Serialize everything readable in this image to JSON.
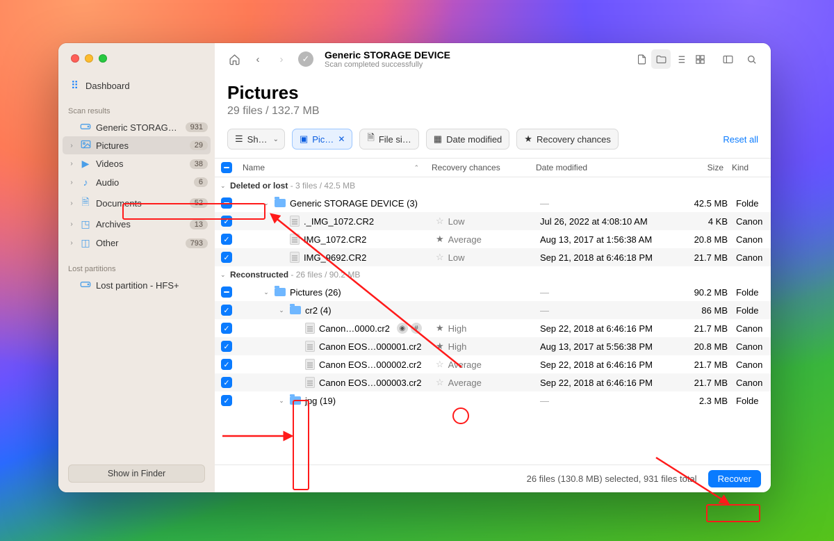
{
  "window": {
    "title": "Generic STORAGE DEVICE",
    "subtitle": "Scan completed successfully"
  },
  "sidebar": {
    "dashboard": "Dashboard",
    "scan_results_label": "Scan results",
    "lost_partitions_label": "Lost partitions",
    "show_in_finder": "Show in Finder",
    "items": [
      {
        "icon": "drive",
        "label": "Generic STORAG…",
        "badge": "931",
        "chev": ""
      },
      {
        "icon": "pic",
        "label": "Pictures",
        "badge": "29",
        "chev": "›",
        "active": true
      },
      {
        "icon": "vid",
        "label": "Videos",
        "badge": "38",
        "chev": "›"
      },
      {
        "icon": "aud",
        "label": "Audio",
        "badge": "6",
        "chev": "›"
      },
      {
        "icon": "doc",
        "label": "Documents",
        "badge": "52",
        "chev": "›"
      },
      {
        "icon": "arc",
        "label": "Archives",
        "badge": "13",
        "chev": "›"
      },
      {
        "icon": "oth",
        "label": "Other",
        "badge": "793",
        "chev": "›"
      }
    ],
    "lost_items": [
      {
        "icon": "drive",
        "label": "Lost partition - HFS+"
      }
    ]
  },
  "heading": {
    "title": "Pictures",
    "subtitle": "29 files / 132.7 MB"
  },
  "filters": {
    "show": "Sh…",
    "pictures": "Pic…",
    "filesize": "File si…",
    "date": "Date modified",
    "recovery": "Recovery chances",
    "reset": "Reset all"
  },
  "columns": {
    "name": "Name",
    "recovery": "Recovery chances",
    "date": "Date modified",
    "size": "Size",
    "kind": "Kind"
  },
  "groups": [
    {
      "title": "Deleted or lost",
      "meta": "3 files / 42.5 MB"
    },
    {
      "title": "Reconstructed",
      "meta": "26 files / 90.2 MB"
    }
  ],
  "rows": [
    {
      "ck": "minus",
      "indent": 0,
      "twisty": "v",
      "kindico": "folder",
      "name": "Generic STORAGE DEVICE (3)",
      "rec": "",
      "date": "—",
      "size": "42.5 MB",
      "kind": "Folde",
      "alt": false
    },
    {
      "ck": "check",
      "indent": 1,
      "twisty": "",
      "kindico": "file",
      "name": "._IMG_1072.CR2",
      "rec": "Low",
      "star": "empty",
      "date": "Jul 26, 2022 at 4:08:10 AM",
      "size": "4 KB",
      "kind": "Canon",
      "alt": true
    },
    {
      "ck": "check",
      "indent": 1,
      "twisty": "",
      "kindico": "file",
      "name": "IMG_1072.CR2",
      "rec": "Average",
      "star": "fill",
      "date": "Aug 13, 2017 at 1:56:38 AM",
      "size": "20.8 MB",
      "kind": "Canon",
      "alt": false
    },
    {
      "ck": "check",
      "indent": 1,
      "twisty": "",
      "kindico": "file",
      "name": "IMG_9692.CR2",
      "rec": "Low",
      "star": "empty",
      "date": "Sep 21, 2018 at 6:46:18 PM",
      "size": "21.7 MB",
      "kind": "Canon",
      "alt": true
    }
  ],
  "rows2": [
    {
      "ck": "minus",
      "indent": 0,
      "twisty": "v",
      "kindico": "folder",
      "name": "Pictures (26)",
      "rec": "",
      "date": "—",
      "size": "90.2 MB",
      "kind": "Folde",
      "alt": false
    },
    {
      "ck": "check",
      "indent": 1,
      "twisty": "v",
      "kindico": "folder",
      "name": "cr2 (4)",
      "rec": "",
      "date": "—",
      "size": "86 MB",
      "kind": "Folde",
      "alt": true
    },
    {
      "ck": "check",
      "indent": 2,
      "twisty": "",
      "kindico": "file",
      "name": "Canon…0000.cr2",
      "rec": "High",
      "star": "fill",
      "eye": true,
      "date": "Sep 22, 2018 at 6:46:16 PM",
      "size": "21.7 MB",
      "kind": "Canon",
      "alt": false
    },
    {
      "ck": "check",
      "indent": 2,
      "twisty": "",
      "kindico": "file",
      "name": "Canon EOS…000001.cr2",
      "rec": "High",
      "star": "fill",
      "date": "Aug 13, 2017 at 5:56:38 PM",
      "size": "20.8 MB",
      "kind": "Canon",
      "alt": true
    },
    {
      "ck": "check",
      "indent": 2,
      "twisty": "",
      "kindico": "file",
      "name": "Canon EOS…000002.cr2",
      "rec": "Average",
      "star": "empty",
      "date": "Sep 22, 2018 at 6:46:16 PM",
      "size": "21.7 MB",
      "kind": "Canon",
      "alt": false
    },
    {
      "ck": "check",
      "indent": 2,
      "twisty": "",
      "kindico": "file",
      "name": "Canon EOS…000003.cr2",
      "rec": "Average",
      "star": "empty",
      "date": "Sep 22, 2018 at 6:46:16 PM",
      "size": "21.7 MB",
      "kind": "Canon",
      "alt": true
    },
    {
      "ck": "check",
      "indent": 1,
      "twisty": "v",
      "kindico": "folder",
      "name": "jpg (19)",
      "rec": "",
      "date": "—",
      "size": "2.3 MB",
      "kind": "Folde",
      "alt": false
    }
  ],
  "footer": {
    "status": "26 files (130.8 MB) selected, 931 files total",
    "recover": "Recover"
  }
}
